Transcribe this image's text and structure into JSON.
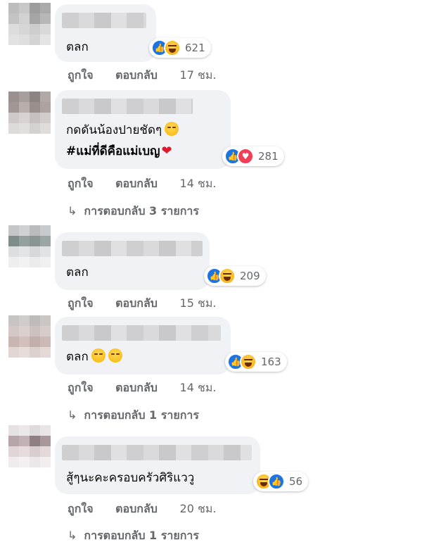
{
  "actions": {
    "like": "ถูกใจ",
    "reply": "ตอบกลับ"
  },
  "comments": [
    {
      "lines": [
        "ตลก"
      ],
      "reactions": [
        "like-icon",
        "haha-icon"
      ],
      "reaction_count": "621",
      "time": "17 ชม."
    },
    {
      "lines": [
        "กดดันน้องปายชัดๆ",
        "#แม่ที่ดีคือแม่เบญ"
      ],
      "reactions": [
        "like-icon",
        "love-icon"
      ],
      "reaction_count": "281",
      "time": "14 ชม.",
      "replies": "การตอบกลับ 3 รายการ"
    },
    {
      "lines": [
        "ตลก"
      ],
      "reactions": [
        "like-icon",
        "haha-icon"
      ],
      "reaction_count": "209",
      "time": "15 ชม."
    },
    {
      "lines": [
        "ตลก"
      ],
      "reactions": [
        "like-icon",
        "haha-icon"
      ],
      "reaction_count": "163",
      "time": "14 ชม.",
      "replies": "การตอบกลับ 1 รายการ"
    },
    {
      "lines": [
        "สู้ๆนะคะครอบครัวศิริแววู"
      ],
      "reactions": [
        "haha-icon",
        "like-icon"
      ],
      "reaction_count": "56",
      "time": "20 ชม.",
      "replies": "การตอบกลับ 1 รายการ"
    }
  ],
  "colors": {
    "bubble": "#f0f2f5",
    "meta_text": "#65676b",
    "like": "#1b74e4",
    "love": "#f33e58",
    "haha": "#f7b500"
  }
}
